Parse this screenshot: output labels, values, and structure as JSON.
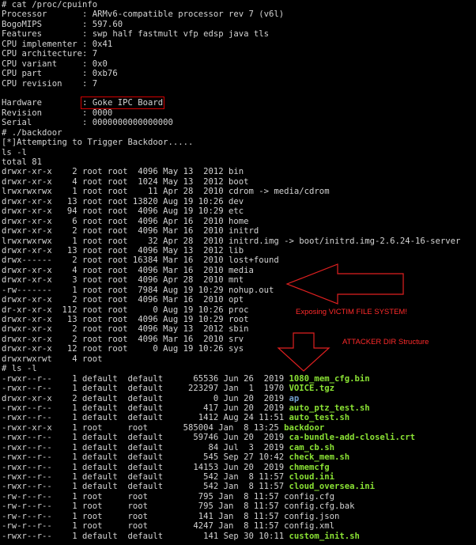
{
  "terminal": {
    "header_lines": [
      "# cat /proc/cpuinfo",
      "Processor       : ARMv6-compatible processor rev 7 (v6l)",
      "BogoMIPS        : 597.60",
      "Features        : swp half fastmult vfp edsp java tls",
      "CPU implementer : 0x41",
      "CPU architecture: 7",
      "CPU variant     : 0x0",
      "CPU part        : 0xb76",
      "CPU revision    : 7",
      ""
    ],
    "hardware_label": "Hardware        ",
    "hardware_value": ": Goke IPC Board",
    "middle_lines": [
      "Revision        : 0000",
      "Serial          : 0000000000000000",
      "# ./backdoor",
      "[*]Attempting to Trigger Backdoor.....",
      "ls -l",
      "total 81",
      "drwxr-xr-x    2 root root  4096 May 13  2012 bin",
      "drwxr-xr-x    4 root root  1024 May 13  2012 boot",
      "lrwxrwxrwx    1 root root    11 Apr 28  2010 cdrom -> media/cdrom",
      "drwxr-xr-x   13 root root 13820 Aug 19 10:26 dev",
      "drwxr-xr-x   94 root root  4096 Aug 19 10:29 etc",
      "drwxr-xr-x    6 root root  4096 Apr 16  2010 home",
      "drwxr-xr-x    2 root root  4096 Mar 16  2010 initrd",
      "lrwxrwxrwx    1 root root    32 Apr 28  2010 initrd.img -> boot/initrd.img-2.6.24-16-server",
      "drwxr-xr-x   13 root root  4096 May 13  2012 lib",
      "drwx------    2 root root 16384 Mar 16  2010 lost+found",
      "drwxr-xr-x    4 root root  4096 Mar 16  2010 media",
      "drwxr-xr-x    3 root root  4096 Apr 28  2010 mnt",
      "-rw-------    1 root root  7984 Aug 19 10:29 nohup.out",
      "drwxr-xr-x    2 root root  4096 Mar 16  2010 opt",
      "dr-xr-xr-x  112 root root     0 Aug 19 10:26 proc",
      "drwxr-xr-x   13 root root  4096 Aug 19 10:29 root",
      "drwxr-xr-x    2 root root  4096 May 13  2012 sbin",
      "drwxr-xr-x    2 root root  4096 Mar 16  2010 srv",
      "drwxr-xr-x   12 root root     0 Aug 19 10:26 sys",
      "drwxrwxrwt    4 root",
      "# ls -l"
    ],
    "listing": [
      {
        "meta": "-rwxr--r--    1 default  default      65536 Jun 26  2019 ",
        "name": "1080_mem_cfg.bin",
        "kind": "exe"
      },
      {
        "meta": "-rwxr--r--    1 default  default     223297 Jan  1  1970 ",
        "name": "VOICE.tgz",
        "kind": "exe"
      },
      {
        "meta": "drwxr-xr-x    2 default  default          0 Jun 20  2019 ",
        "name": "ap",
        "kind": "dir"
      },
      {
        "meta": "-rwxr--r--    1 default  default        417 Jun 20  2019 ",
        "name": "auto_ptz_test.sh",
        "kind": "exe"
      },
      {
        "meta": "-rwxr--r--    1 default  default       1412 Aug 24 11:51 ",
        "name": "auto_test.sh",
        "kind": "exe"
      },
      {
        "meta": "-rwxr-xr-x    1 root     root       585004 Jan  8 13:25 ",
        "name": "backdoor",
        "kind": "exe"
      },
      {
        "meta": "-rwxr--r--    1 default  default      59746 Jun 20  2019 ",
        "name": "ca-bundle-add-closeli.crt",
        "kind": "exe"
      },
      {
        "meta": "-rwxr--r--    1 default  default         84 Jul  3  2019 ",
        "name": "cam_cb.sh",
        "kind": "exe"
      },
      {
        "meta": "-rwxr--r--    1 default  default        545 Sep 27 10:42 ",
        "name": "check_mem.sh",
        "kind": "exe"
      },
      {
        "meta": "-rwxr--r--    1 default  default      14153 Jun 20  2019 ",
        "name": "chmemcfg",
        "kind": "exe"
      },
      {
        "meta": "-rwxr--r--    1 default  default        542 Jan  8 11:57 ",
        "name": "cloud.ini",
        "kind": "exe"
      },
      {
        "meta": "-rwxr--r--    1 default  default        542 Jan  8 11:57 ",
        "name": "cloud_oversea.ini",
        "kind": "exe"
      },
      {
        "meta": "-rw-r--r--    1 root     root          795 Jan  8 11:57 ",
        "name": "config.cfg",
        "kind": "plain"
      },
      {
        "meta": "-rw-r--r--    1 root     root          795 Jan  8 11:57 ",
        "name": "config.cfg.bak",
        "kind": "plain"
      },
      {
        "meta": "-rw-r--r--    1 root     root          141 Jan  8 11:57 ",
        "name": "config.json",
        "kind": "plain"
      },
      {
        "meta": "-rw-r--r--    1 root     root         4247 Jan  8 11:57 ",
        "name": "config.xml",
        "kind": "plain"
      },
      {
        "meta": "-rwxr--r--    1 default  default        141 Sep 30 10:11 ",
        "name": "custom_init.sh",
        "kind": "exe"
      }
    ]
  },
  "annotations": {
    "victim_fs": "Exposing VICTIM FILE SYSTEM!",
    "attacker_dir": "ATTACKER DIR Structure",
    "color": "#ff2a2a"
  },
  "colors": {
    "background": "#000000",
    "text": "#d3d3d3",
    "executable": "#8ae234",
    "directory": "#729fcf",
    "highlight_box": "#d40000"
  }
}
